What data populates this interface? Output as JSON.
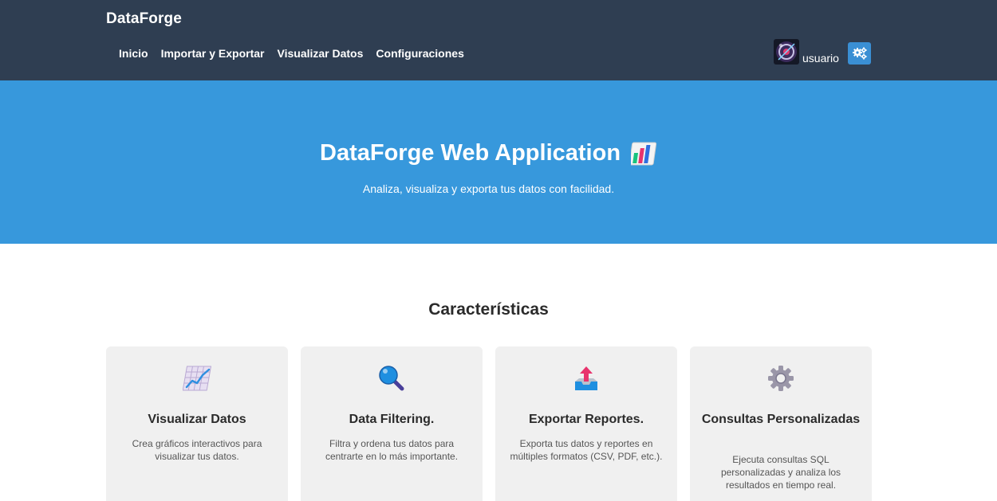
{
  "navbar": {
    "brand": "DataForge",
    "links": [
      "Inicio",
      "Importar y Exportar",
      "Visualizar Datos",
      "Configuraciones"
    ],
    "username": "usuario",
    "avatar_icon": "avatar-image",
    "settings_icon": "gears-icon"
  },
  "hero": {
    "title": "DataForge Web Application",
    "title_icon": "bar-chart-icon",
    "subtitle": "Analiza, visualiza y exporta tus datos con facilidad."
  },
  "features": {
    "title": "Características",
    "cards": [
      {
        "icon": "chart-increasing-icon",
        "title": "Visualizar Datos",
        "text": "Crea gráficos interactivos para visualizar tus datos."
      },
      {
        "icon": "magnifying-glass-icon",
        "title": "Data Filtering.",
        "text": "Filtra y ordena tus datos para centrarte en lo más importante."
      },
      {
        "icon": "outbox-tray-icon",
        "title": "Exportar Reportes.",
        "text": "Exporta tus datos y reportes en múltiples formatos (CSV, PDF, etc.)."
      },
      {
        "icon": "gear-icon",
        "title": "Consultas Personalizadas",
        "text": "Ejecuta consultas SQL personalizadas y analiza los resultados en tiempo real."
      }
    ]
  },
  "colors": {
    "navbar_bg": "#2f3e52",
    "hero_bg": "#3798dc",
    "card_bg": "#f0f0f0",
    "settings_button": "#3a8fd4"
  }
}
